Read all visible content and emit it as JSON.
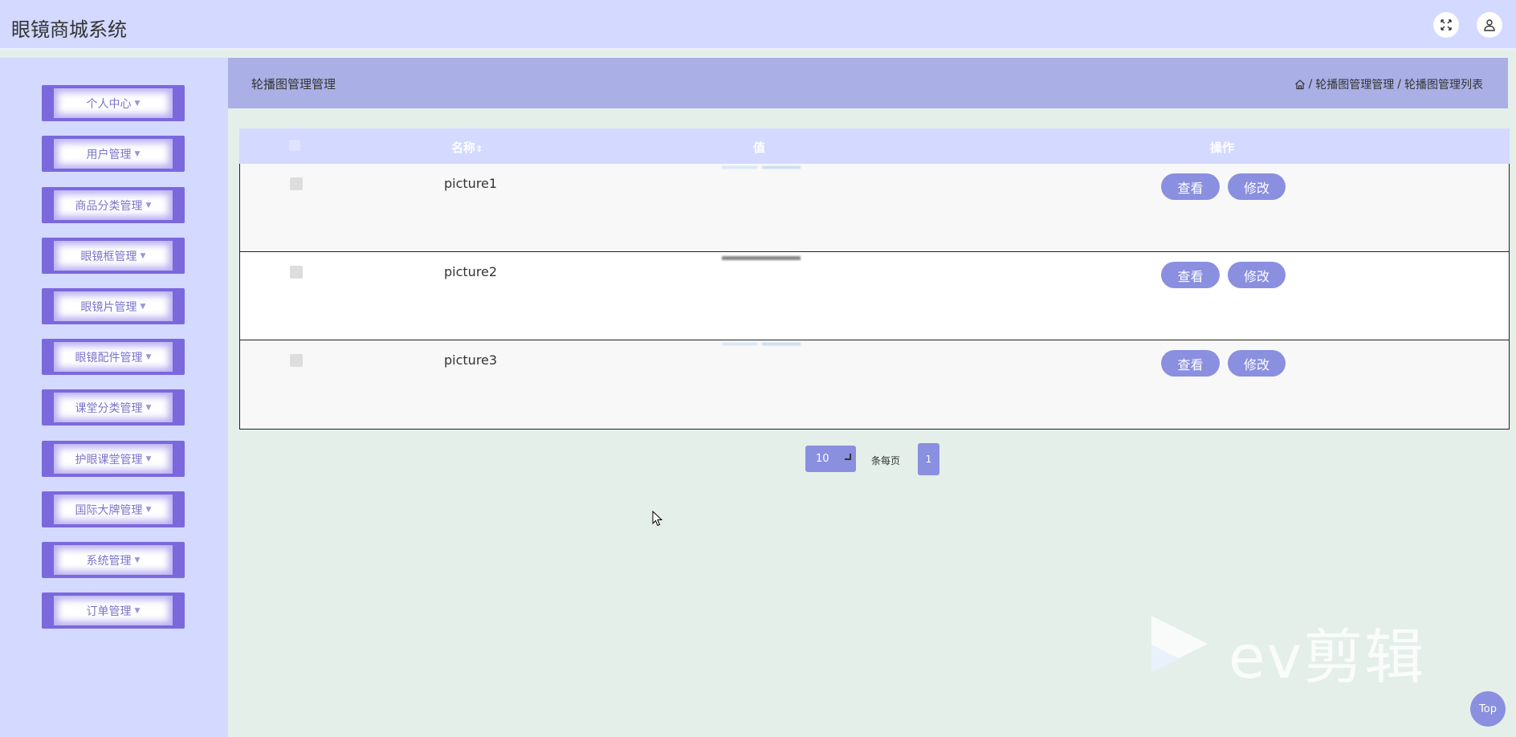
{
  "app": {
    "title": "眼镜商城系统"
  },
  "header": {
    "icons": [
      "fullscreen-icon",
      "user-icon"
    ]
  },
  "sidebar": {
    "items": [
      {
        "label": "个人中心"
      },
      {
        "label": "用户管理"
      },
      {
        "label": "商品分类管理"
      },
      {
        "label": "眼镜框管理"
      },
      {
        "label": "眼镜片管理"
      },
      {
        "label": "眼镜配件管理"
      },
      {
        "label": "课堂分类管理"
      },
      {
        "label": "护眼课堂管理"
      },
      {
        "label": "国际大牌管理"
      },
      {
        "label": "系统管理"
      },
      {
        "label": "订单管理"
      }
    ],
    "caret": "▼"
  },
  "content": {
    "title": "轮播图管理管理",
    "breadcrumb": {
      "separator": "/",
      "items": [
        "轮播图管理管理",
        "轮播图管理列表"
      ]
    }
  },
  "table": {
    "columns": {
      "name": "名称",
      "sort_icon": "⇕",
      "value": "值",
      "actions": "操作"
    },
    "rows": [
      {
        "name": "picture1",
        "view": "查看",
        "edit": "修改"
      },
      {
        "name": "picture2",
        "view": "查看",
        "edit": "修改"
      },
      {
        "name": "picture3",
        "view": "查看",
        "edit": "修改"
      }
    ]
  },
  "pagination": {
    "page_size": "10",
    "page_size_label": "条每页",
    "current_page": "1"
  },
  "watermark": {
    "text": "ev剪辑"
  },
  "back_to_top": {
    "label": "Top"
  },
  "colors": {
    "header_bg": "#d3d9ff",
    "sidebar_bg": "#d3d9ff",
    "content_bar_bg": "#aab0e6",
    "accent": "#8a8fdf",
    "menu_border": "#7b68dd",
    "page_bg": "#e4efea"
  }
}
